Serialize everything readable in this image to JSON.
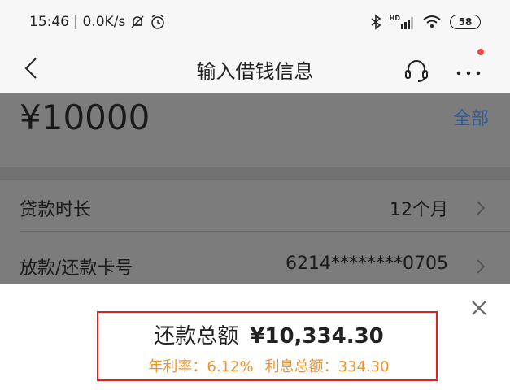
{
  "status_bar": {
    "time_speed": "15:46 | 0.0K/s",
    "hd_label": "HD",
    "battery": "58"
  },
  "nav": {
    "title": "输入借钱信息"
  },
  "loan": {
    "amount": "¥10000",
    "all_link": "全部",
    "rows": [
      {
        "label": "贷款时长",
        "value": "12个月"
      },
      {
        "label": "放款/还款卡号",
        "value": "6214********0705"
      }
    ]
  },
  "summary": {
    "total_label": "还款总额",
    "total_value": "¥10,334.30",
    "rate_label": "年利率：",
    "rate_value": "6.12%",
    "interest_label": "利息总额：",
    "interest_value": "334.30"
  },
  "colors": {
    "accent_orange": "#f0922a",
    "link_blue": "#2f5c9a",
    "highlight_red": "#e02020",
    "badge_red": "#f04b4b"
  }
}
